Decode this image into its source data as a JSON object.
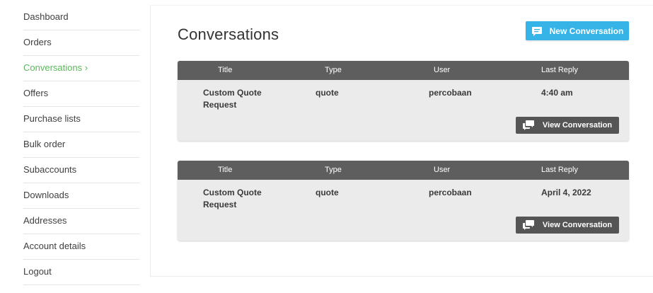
{
  "sidebar": {
    "items": [
      {
        "label": "Dashboard"
      },
      {
        "label": "Orders"
      },
      {
        "label": "Conversations ›",
        "active": true
      },
      {
        "label": "Offers"
      },
      {
        "label": "Purchase lists"
      },
      {
        "label": "Bulk order"
      },
      {
        "label": "Subaccounts"
      },
      {
        "label": "Downloads"
      },
      {
        "label": "Addresses"
      },
      {
        "label": "Account details"
      },
      {
        "label": "Logout"
      }
    ]
  },
  "main": {
    "title": "Conversations",
    "new_button_label": "New Conversation",
    "columns": {
      "title": "Title",
      "type": "Type",
      "user": "User",
      "last_reply": "Last Reply"
    },
    "conversations": [
      {
        "title": "Custom Quote Request",
        "type": "quote",
        "user": "percobaan",
        "last_reply": "4:40 am",
        "button_label": "View Conversation"
      },
      {
        "title": "Custom Quote Request",
        "type": "quote",
        "user": "percobaan",
        "last_reply": "April 4, 2022",
        "button_label": "View Conversation"
      }
    ]
  },
  "colors": {
    "accent_active": "#5cb85c",
    "new_button": "#36b4e8",
    "card_header": "#5e5e5e",
    "card_body": "#ebebeb",
    "view_button": "#555555"
  },
  "icons": {
    "new_button": "chat-bubble-icon",
    "view_button": "conversation-icon"
  }
}
